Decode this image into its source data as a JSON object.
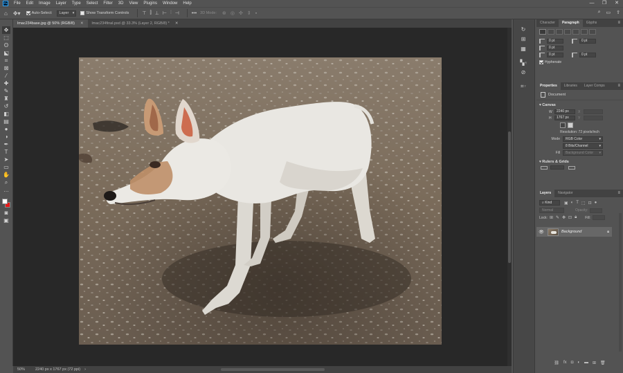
{
  "menu": {
    "items": [
      "File",
      "Edit",
      "Image",
      "Layer",
      "Type",
      "Select",
      "Filter",
      "3D",
      "View",
      "Plugins",
      "Window",
      "Help"
    ],
    "window_controls": [
      "—",
      "❐",
      "✕"
    ]
  },
  "options": {
    "auto_select_label": "Auto-Select:",
    "auto_select_target": "Layer",
    "transform_label": "Show Transform Controls",
    "mode_3d_label": "3D Mode:"
  },
  "tabs": [
    {
      "label": "lmac234base.jpg @ 50% (RGB/8)",
      "active": true
    },
    {
      "label": "lmac234final.psd @ 33.3% (Layer 2, RGB/8) *",
      "active": false
    }
  ],
  "status": {
    "zoom": "50%",
    "doc_info": "2240 px x 1767 px (72 ppi)"
  },
  "mini_labels": {
    "paragraph": "¶",
    "type": "T"
  },
  "top_panel": {
    "tabs": [
      "Character",
      "Paragraph",
      "Glyphs"
    ],
    "active_tab": "Paragraph",
    "indent_values": [
      "0 pt",
      "0 pt",
      "0 pt",
      "0 pt",
      "0 pt"
    ],
    "hyphenate_label": "Hyphenate"
  },
  "properties": {
    "tabs": [
      "Properties",
      "Libraries",
      "Layer Comps"
    ],
    "active_tab": "Properties",
    "doc_label": "Document",
    "canvas_title": "Canvas",
    "width_key": "W",
    "width_value": "2240 px",
    "height_key": "H",
    "height_value": "1767 px",
    "x_key": "X",
    "y_key": "Y",
    "resolution": "Resolution: 72 pixels/inch",
    "mode_label": "Mode",
    "mode_value": "RGB Color",
    "bits_value": "8 Bits/Channel",
    "fill_label": "Fill",
    "fill_value": "Background Color",
    "rulers_title": "Rulers & Grids"
  },
  "layers": {
    "tabs": [
      "Layers",
      "Navigator"
    ],
    "active_tab": "Layers",
    "kind_label": "Kind",
    "blend_mode": "Normal",
    "opacity_label": "Opacity:",
    "lock_label": "Lock:",
    "fill_label": "Fill:",
    "layer_name": "Background"
  },
  "colors": {
    "foreground": "#ffffff",
    "background": "#e81818",
    "ps_blue": "#31a8ff"
  }
}
